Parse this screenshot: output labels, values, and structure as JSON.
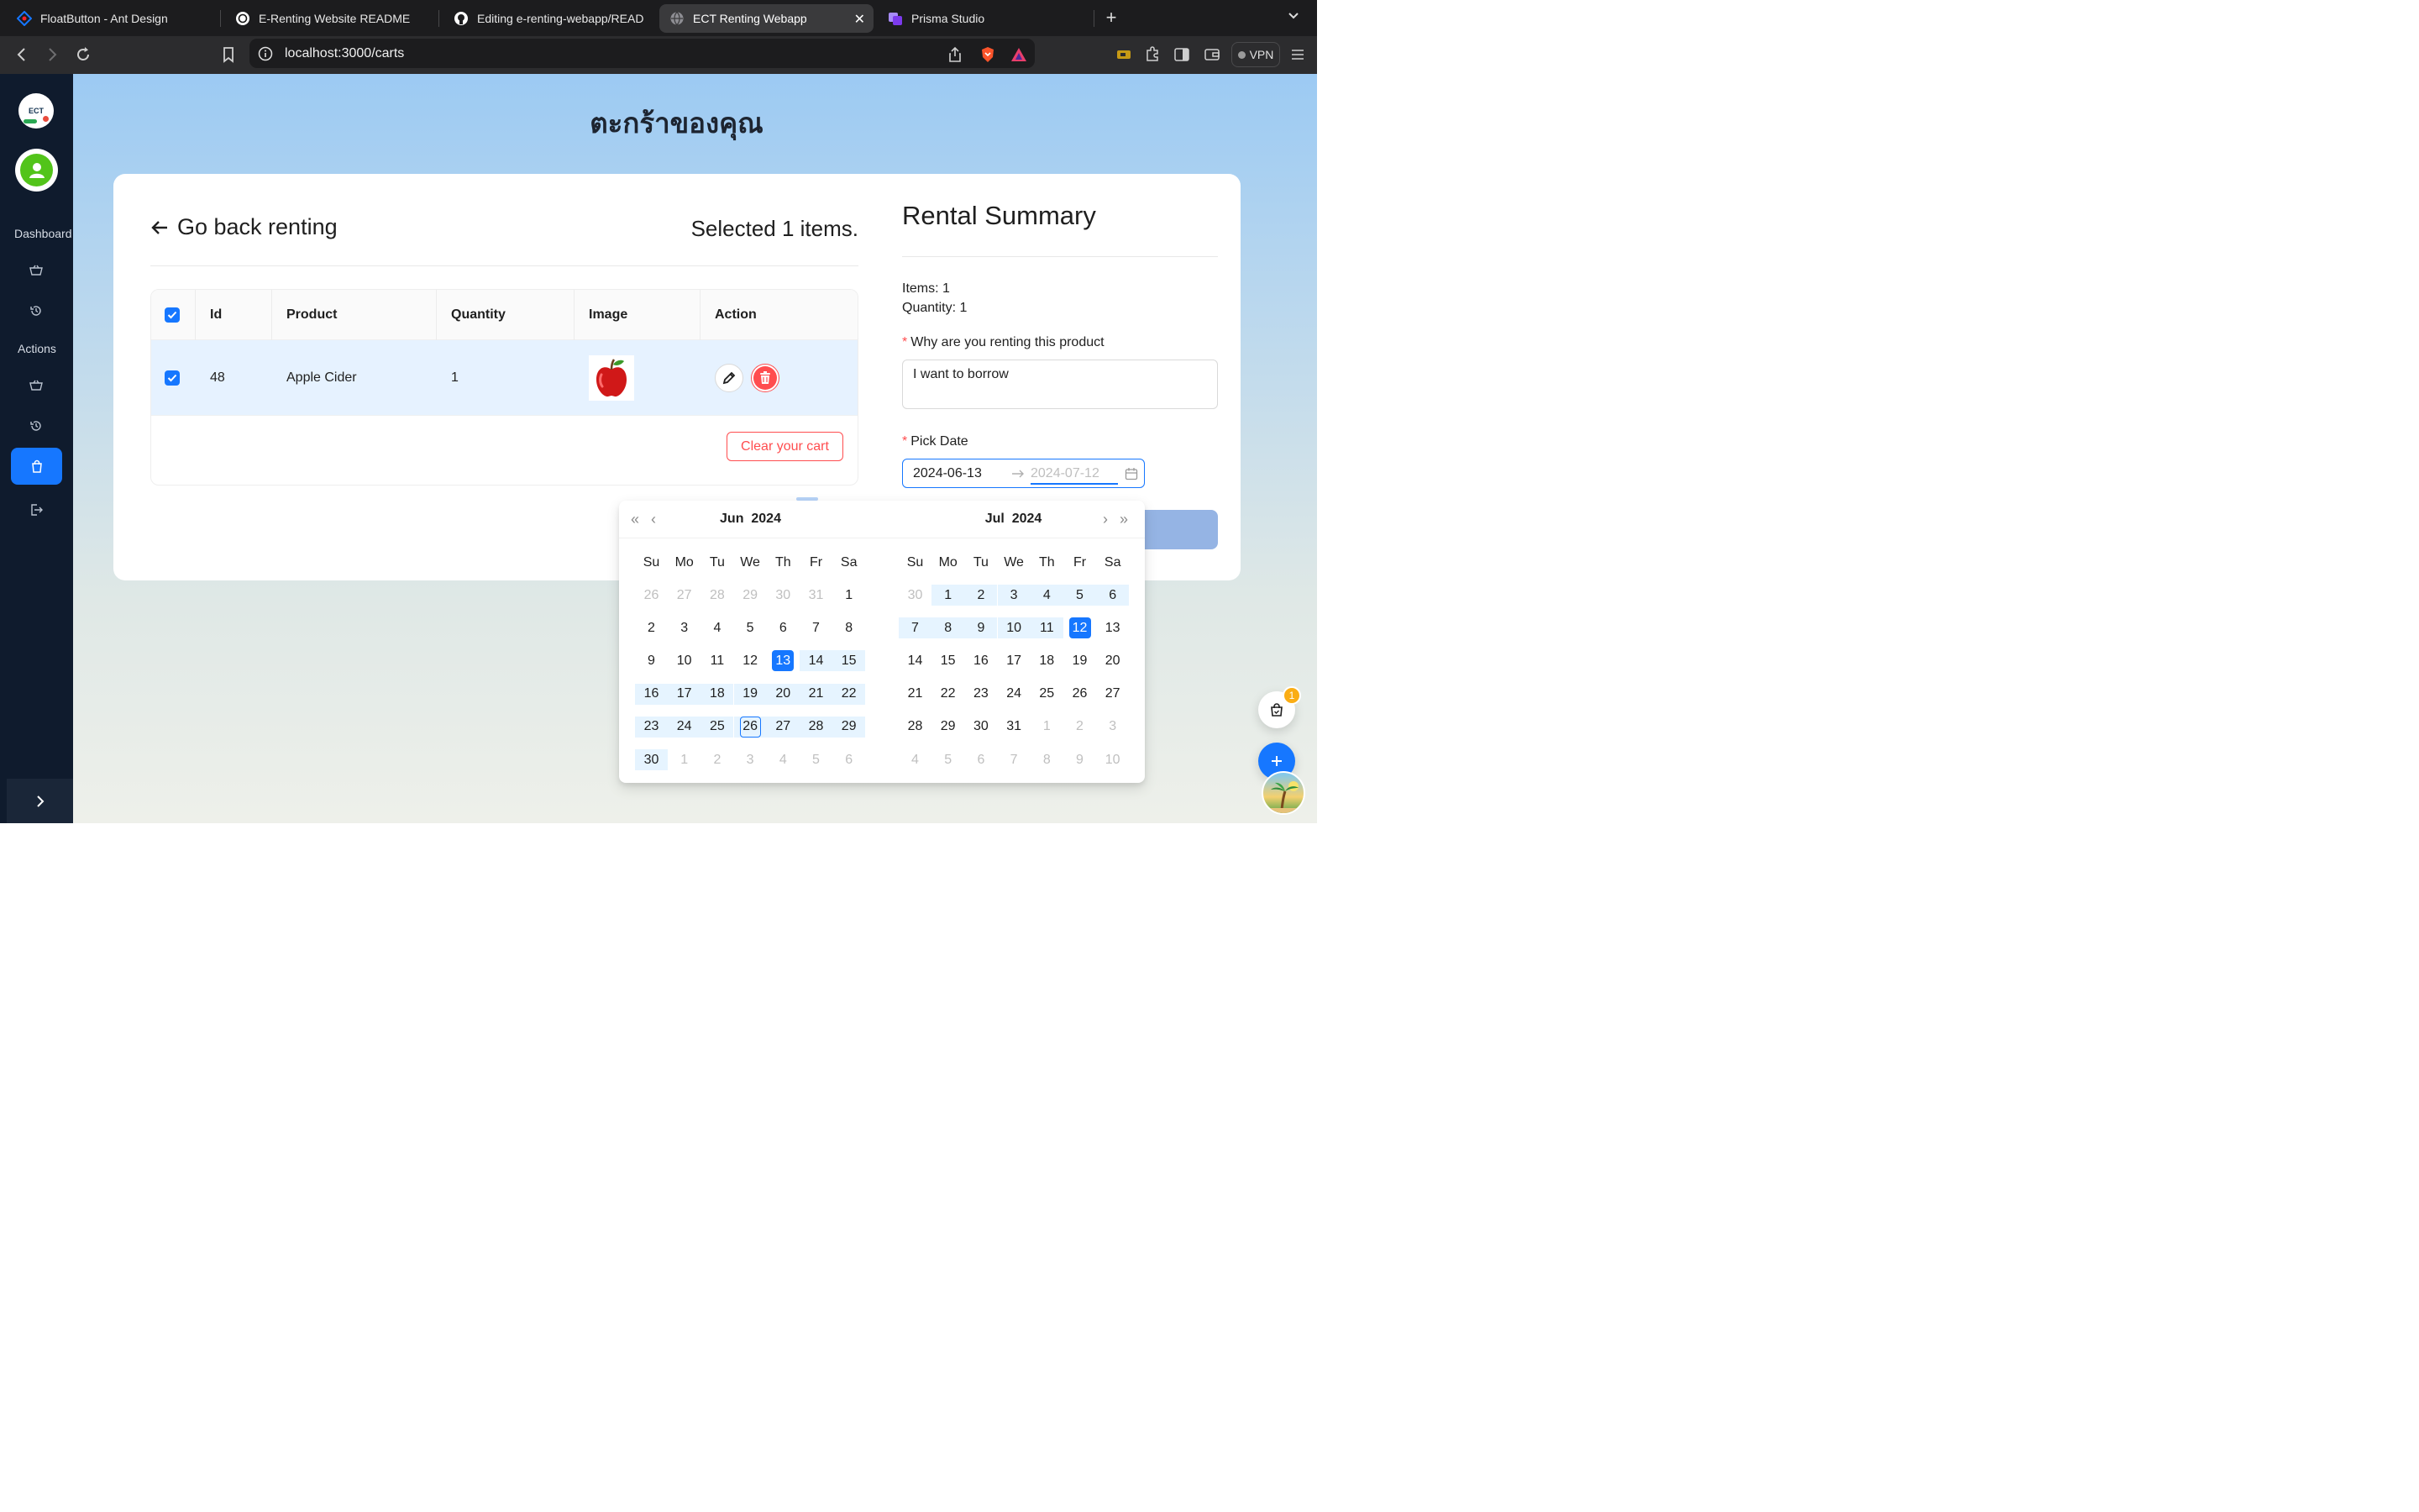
{
  "browser": {
    "tabs": [
      {
        "label": "FloatButton - Ant Design",
        "icon": "ant-design-icon"
      },
      {
        "label": "E-Renting Website README",
        "icon": "openai-icon"
      },
      {
        "label": "Editing e-renting-webapp/README.md",
        "icon": "github-icon"
      },
      {
        "label": "ECT Renting Webapp",
        "icon": "globe-icon",
        "active": true
      },
      {
        "label": "Prisma Studio",
        "icon": "prisma-icon"
      }
    ],
    "url": "localhost:3000/carts",
    "vpn_label": "VPN"
  },
  "sidebar": {
    "logo_text": "ECT",
    "section_dashboard": "Dashboard",
    "section_actions": "Actions"
  },
  "page": {
    "title": "ตะกร้าของคุณ",
    "back_label": "Go back renting",
    "selected_text": "Selected 1 items.",
    "clear_label": "Clear your cart"
  },
  "table": {
    "headers": {
      "id": "Id",
      "product": "Product",
      "quantity": "Quantity",
      "image": "Image",
      "action": "Action"
    },
    "rows": [
      {
        "id": "48",
        "product": "Apple Cider",
        "quantity": "1",
        "image": "🍎",
        "checked": true
      }
    ]
  },
  "summary": {
    "title": "Rental Summary",
    "items_line": "Items: 1",
    "quantity_line": "Quantity: 1",
    "reason_label": "Why are you renting this product",
    "reason_value": "I want to borrow",
    "pick_date_label": "Pick Date",
    "date_start": "2024-06-13",
    "date_end": "2024-07-12"
  },
  "calendar": {
    "left_month": "Jun",
    "left_year": "2024",
    "right_month": "Jul",
    "right_year": "2024",
    "weekdays": [
      "Su",
      "Mo",
      "Tu",
      "We",
      "Th",
      "Fr",
      "Sa"
    ],
    "left_days": [
      "26",
      "27",
      "28",
      "29",
      "30",
      "31",
      "1",
      "2",
      "3",
      "4",
      "5",
      "6",
      "7",
      "8",
      "9",
      "10",
      "11",
      "12",
      "13",
      "14",
      "15",
      "16",
      "17",
      "18",
      "19",
      "20",
      "21",
      "22",
      "23",
      "24",
      "25",
      "26",
      "27",
      "28",
      "29",
      "30",
      "1",
      "2",
      "3",
      "4",
      "5",
      "6"
    ],
    "right_days": [
      "30",
      "1",
      "2",
      "3",
      "4",
      "5",
      "6",
      "7",
      "8",
      "9",
      "10",
      "11",
      "12",
      "13",
      "14",
      "15",
      "16",
      "17",
      "18",
      "19",
      "20",
      "21",
      "22",
      "23",
      "24",
      "25",
      "26",
      "27",
      "28",
      "29",
      "30",
      "31",
      "1",
      "2",
      "3",
      "4",
      "5",
      "6",
      "7",
      "8",
      "9",
      "10"
    ]
  },
  "float": {
    "cart_badge": "1"
  },
  "colors": {
    "primary": "#1677ff",
    "danger": "#ff4d4f",
    "sidebar_bg": "#0f1b2d",
    "range_bg": "#e6f4ff"
  }
}
